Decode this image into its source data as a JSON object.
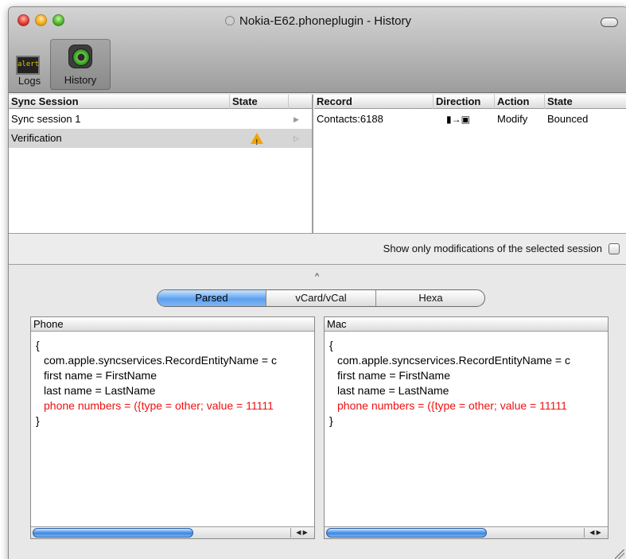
{
  "window": {
    "title": "Nokia-E62.phoneplugin - History"
  },
  "toolbar": {
    "logs_label": "Logs",
    "logs_icon_text": "alert",
    "history_label": "History",
    "selected": "History"
  },
  "sessions": {
    "columns": [
      "Sync Session",
      "State"
    ],
    "rows": [
      {
        "name": "Sync session 1",
        "state_icon": "",
        "selected": false
      },
      {
        "name": "Verification",
        "state_icon": "warning-icon",
        "selected": true
      }
    ]
  },
  "records": {
    "columns": [
      "Record",
      "Direction",
      "Action",
      "State"
    ],
    "rows": [
      {
        "record": "Contacts:6188",
        "direction_icon": "phone-to-mac-icon",
        "action": "Modify",
        "state": "Bounced"
      }
    ]
  },
  "options": {
    "show_only_label": "Show only modifications of the selected session",
    "show_only_checked": false
  },
  "view_tabs": {
    "items": [
      "Parsed",
      "vCard/vCal",
      "Hexa"
    ],
    "selected": "Parsed"
  },
  "phone_pane": {
    "header": "Phone",
    "lines": [
      "{",
      "com.apple.syncservices.RecordEntityName = c",
      "first name = FirstName",
      "last name = LastName",
      "phone numbers = ({type = other; value = 11111",
      "}"
    ]
  },
  "mac_pane": {
    "header": "Mac",
    "lines": [
      "{",
      "com.apple.syncservices.RecordEntityName = c",
      "first name = FirstName",
      "last name = LastName",
      "phone numbers = ({type = other; value = 11111",
      "}"
    ]
  },
  "colors": {
    "diff_highlight": "#ee1111",
    "selection": "#d6d6d6",
    "segment_selected": "#5ca0ef"
  }
}
